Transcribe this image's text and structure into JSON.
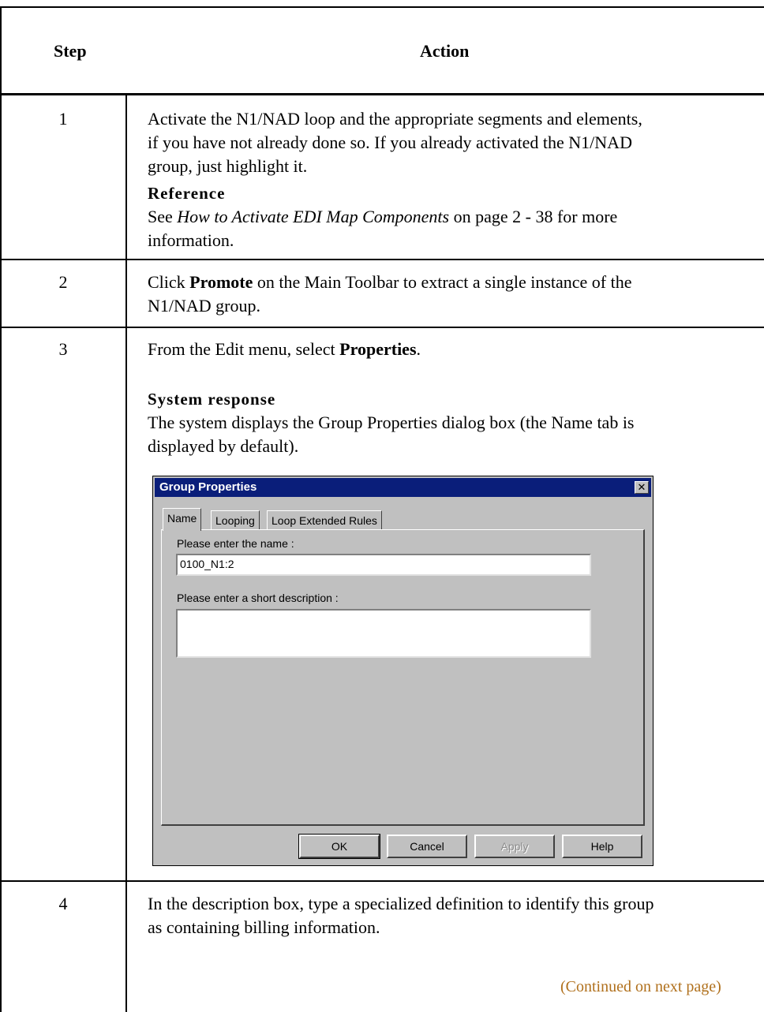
{
  "table": {
    "header": {
      "step": "Step",
      "action": "Action"
    },
    "rows": [
      {
        "step": "1",
        "text_lines": [
          "Activate the N1/NAD loop and the appropriate segments and elements,",
          "if you have not already done so. If you already activated the N1/NAD",
          "group, just highlight it."
        ],
        "reference_heading": "Reference",
        "reference_pre": "See ",
        "reference_italic": "How to Activate EDI Map Components",
        "reference_post": " on page 2 - 38 for more",
        "reference_line2": "information."
      },
      {
        "step": "2",
        "line1_pre": "Click ",
        "line1_bold": "Promote",
        "line1_post": " on the Main Toolbar to extract a single instance of the",
        "line2": "N1/NAD group."
      },
      {
        "step": "3",
        "line1_pre": "From the Edit menu, select ",
        "line1_bold": "Properties",
        "line1_post": ".",
        "response_heading": "System response",
        "response_line1": "The system displays the Group Properties dialog box (the Name tab is",
        "response_line2": "displayed by default)."
      },
      {
        "step": "4",
        "line1": "In the description box, type a specialized definition to identify this group",
        "line2": "as containing billing information.",
        "continued": "(Continued on next page)"
      }
    ]
  },
  "dialog": {
    "title": "Group Properties",
    "close": "✕",
    "tabs": [
      "Name",
      "Looping",
      "Loop Extended Rules"
    ],
    "name_label": "Please enter the name :",
    "name_value": "0100_N1:2",
    "desc_label": "Please enter a short description :",
    "desc_value": "",
    "buttons": {
      "ok": "OK",
      "cancel": "Cancel",
      "apply": "Apply",
      "help": "Help"
    }
  }
}
